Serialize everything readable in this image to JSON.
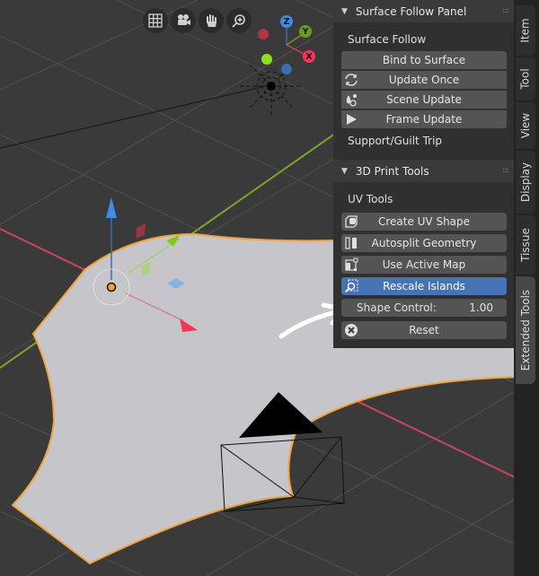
{
  "viewport": {
    "nav_buttons": [
      {
        "name": "toggle-ortho",
        "icon": "grid-icon"
      },
      {
        "name": "camera-view",
        "icon": "camera-icon"
      },
      {
        "name": "pan-view",
        "icon": "hand-icon"
      },
      {
        "name": "zoom-view",
        "icon": "zoom-in-icon"
      }
    ],
    "gizmo_axes": {
      "z": "Z",
      "y": "Y",
      "x": "X"
    },
    "colors": {
      "background": "#3a3a3a",
      "grid_line": "#4a4a4a",
      "x_axis": "#d9485f",
      "y_axis": "#7fb02a",
      "mesh_face": "#c8c8cc",
      "selection_outline": "#f2a33a",
      "z_gizmo": "#3d8ee8",
      "x_gizmo": "#f2365a",
      "y_gizmo": "#6f9a1f"
    }
  },
  "panels": {
    "surface_follow": {
      "title": "Surface Follow Panel",
      "section": "Surface Follow",
      "buttons": [
        {
          "label": "Bind to Surface",
          "icon": ""
        },
        {
          "label": "Update Once",
          "icon": "refresh-icon"
        },
        {
          "label": "Scene Update",
          "icon": "physics-icon"
        },
        {
          "label": "Frame Update",
          "icon": "play-icon"
        }
      ],
      "footer_label": "Support/Guilt Trip"
    },
    "print_tools": {
      "title": "3D Print Tools",
      "section": "UV Tools",
      "buttons": [
        {
          "label": "Create UV Shape",
          "icon": "uv-shape-icon"
        },
        {
          "label": "Autosplit Geometry",
          "icon": "split-icon"
        },
        {
          "label": "Use Active Map",
          "icon": "uv-map-icon"
        },
        {
          "label": "Rescale Islands",
          "icon": "rescale-icon",
          "active": true
        }
      ],
      "shape_control": {
        "label": "Shape Control:",
        "value": "1.00"
      },
      "reset": {
        "label": "Reset",
        "icon": "x-circle-icon"
      }
    }
  },
  "tabs": [
    {
      "label": "Item",
      "active": false
    },
    {
      "label": "Tool",
      "active": false
    },
    {
      "label": "View",
      "active": false
    },
    {
      "label": "Display",
      "active": false
    },
    {
      "label": "Tissue",
      "active": false
    },
    {
      "label": "Extended Tools",
      "active": true
    }
  ]
}
